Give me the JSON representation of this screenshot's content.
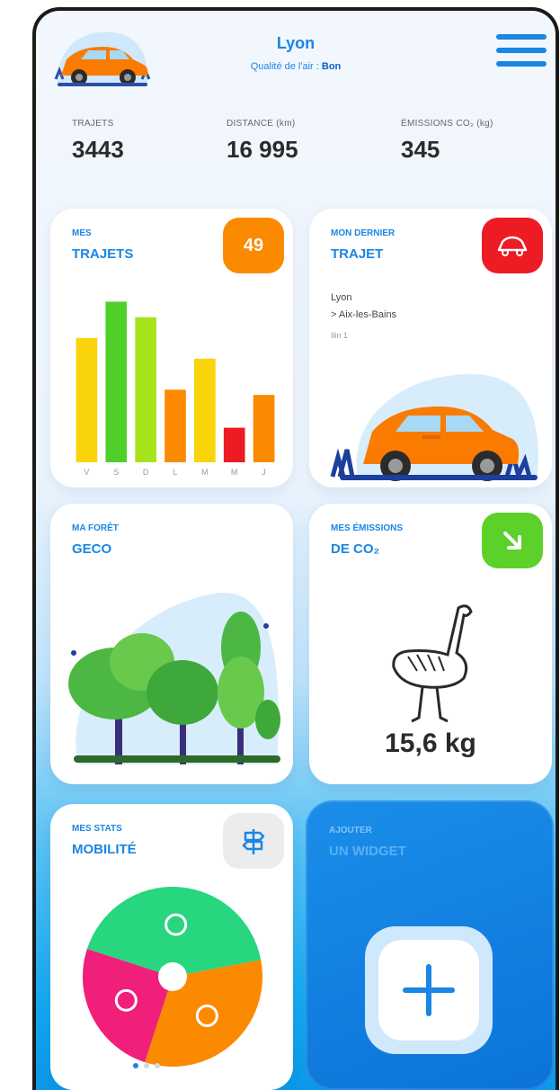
{
  "header": {
    "city": "Lyon",
    "air_quality_label": "Qualité de l'air :",
    "air_quality_value": "Bon"
  },
  "stats": [
    {
      "label": "TRAJETS",
      "value": "3443"
    },
    {
      "label": "DISTANCE (km)",
      "value": "16 995"
    },
    {
      "label": "ÉMISSIONS CO₂ (kg)",
      "value": "345"
    }
  ],
  "widgets": {
    "trips": {
      "title_top": "MES",
      "title_bottom": "TRAJETS",
      "badge": "49",
      "days": [
        "V",
        "S",
        "D",
        "L",
        "M",
        "M",
        "J"
      ],
      "bars": [
        {
          "value": 0.72,
          "color": "#f9d40a"
        },
        {
          "value": 0.93,
          "color": "#4fcf2a"
        },
        {
          "value": 0.84,
          "color": "#a6e31a"
        },
        {
          "value": 0.42,
          "color": "#fb8a00"
        },
        {
          "value": 0.6,
          "color": "#f9d40a"
        },
        {
          "value": 0.2,
          "color": "#ec1b24"
        },
        {
          "value": 0.39,
          "color": "#fb8a00"
        }
      ]
    },
    "last_trip": {
      "title_top": "MON DERNIER",
      "title_bottom": "TRAJET",
      "route_from": "Lyon",
      "route_to": "> Aix-les-Bains",
      "date": "Ilin 1"
    },
    "forest": {
      "title_top": "MA FORÊT",
      "title_bottom": "GECO"
    },
    "emissions": {
      "title_top": "MES ÉMISSIONS",
      "title_bottom": "DE CO₂",
      "value": "15,6 kg"
    },
    "mobility": {
      "title_top": "MES STATS",
      "title_bottom": "MOBILITÉ",
      "slices": [
        {
          "name": "walking-icon",
          "fraction": 0.42,
          "color": "#27d67e"
        },
        {
          "name": "car-icon",
          "fraction": 0.33,
          "color": "#fb8a00"
        },
        {
          "name": "bus-icon",
          "fraction": 0.25,
          "color": "#ef1f7a"
        }
      ]
    },
    "add": {
      "title_top": "AJOUTER",
      "title_bottom": "UN WIDGET"
    }
  },
  "pagination": {
    "count": 3,
    "active": 0
  },
  "colors": {
    "accent": "#1a86e4",
    "orange": "#fb8a00",
    "red": "#ec1b24",
    "green": "#5bd12a"
  }
}
